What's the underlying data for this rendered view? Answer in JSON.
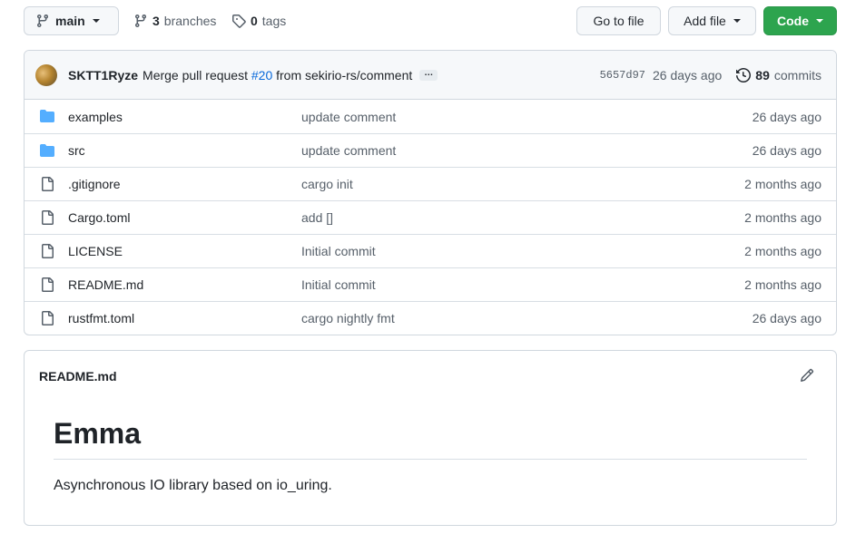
{
  "toolbar": {
    "branch_label": "main",
    "branches_count": "3",
    "branches_label": "branches",
    "tags_count": "0",
    "tags_label": "tags",
    "goto_file_label": "Go to file",
    "add_file_label": "Add file",
    "code_label": "Code"
  },
  "commit": {
    "author": "SKTT1Ryze",
    "message_prefix": "Merge pull request",
    "pr_link": "#20",
    "message_suffix": "from sekirio-rs/comment",
    "ellipsis": "…",
    "sha": "5657d97",
    "age": "26 days ago",
    "commits_count": "89",
    "commits_label": "commits"
  },
  "files": [
    {
      "name": "examples",
      "type": "folder",
      "message": "update comment",
      "age": "26 days ago"
    },
    {
      "name": "src",
      "type": "folder",
      "message": "update comment",
      "age": "26 days ago"
    },
    {
      "name": ".gitignore",
      "type": "file",
      "message": "cargo init",
      "age": "2 months ago"
    },
    {
      "name": "Cargo.toml",
      "type": "file",
      "message": "add []",
      "age": "2 months ago"
    },
    {
      "name": "LICENSE",
      "type": "file",
      "message": "Initial commit",
      "age": "2 months ago"
    },
    {
      "name": "README.md",
      "type": "file",
      "message": "Initial commit",
      "age": "2 months ago"
    },
    {
      "name": "rustfmt.toml",
      "type": "file",
      "message": "cargo nightly fmt",
      "age": "26 days ago"
    }
  ],
  "readme": {
    "header": "README.md",
    "title": "Emma",
    "description": "Asynchronous IO library based on io_uring."
  },
  "colors": {
    "accent_green": "#2da44e",
    "link_blue": "#0969da",
    "folder_blue": "#54aeff"
  },
  "icons": {
    "branch": "git-branch-icon",
    "tag": "tag-icon",
    "history": "history-icon",
    "folder": "folder-icon",
    "file": "file-icon",
    "edit": "pencil-icon"
  }
}
